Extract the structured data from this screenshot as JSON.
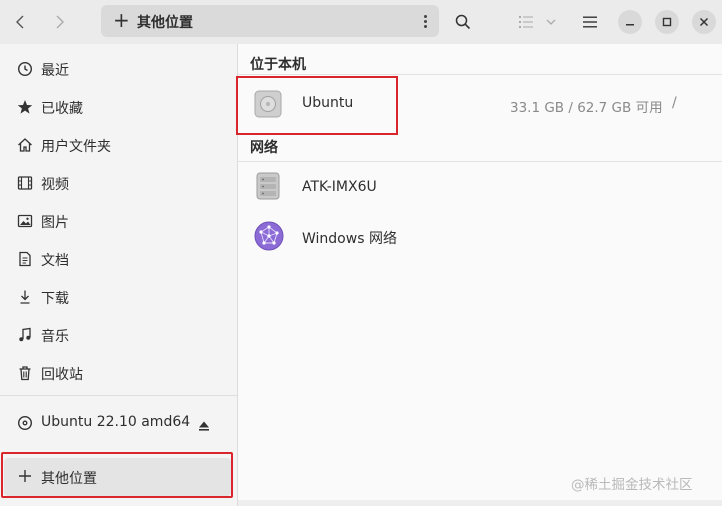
{
  "header": {
    "path_label": "其他位置"
  },
  "sidebar": {
    "items": [
      {
        "label": "最近",
        "icon": "clock-icon"
      },
      {
        "label": "已收藏",
        "icon": "star-icon"
      },
      {
        "label": "用户文件夹",
        "icon": "home-icon"
      },
      {
        "label": "视频",
        "icon": "film-icon"
      },
      {
        "label": "图片",
        "icon": "image-icon"
      },
      {
        "label": "文档",
        "icon": "document-icon"
      },
      {
        "label": "下载",
        "icon": "download-icon"
      },
      {
        "label": "音乐",
        "icon": "music-icon"
      },
      {
        "label": "回收站",
        "icon": "trash-icon"
      }
    ],
    "device": {
      "label": "Ubuntu 22.10 amd64",
      "icon": "disc-icon"
    },
    "other_locations": {
      "label": "其他位置",
      "icon": "plus-icon"
    }
  },
  "main": {
    "local_section": "位于本机",
    "local_items": [
      {
        "name": "Ubuntu",
        "info": "33.1 GB / 62.7 GB 可用",
        "mount": "/",
        "icon": "drive-icon"
      }
    ],
    "network_section": "网络",
    "network_items": [
      {
        "name": "ATK-IMX6U",
        "icon": "server-icon"
      },
      {
        "name": "Windows 网络",
        "icon": "network-globe-icon"
      }
    ]
  },
  "watermark": "@稀土掘金技术社区",
  "colors": {
    "highlight_border": "#d9262c",
    "network_icon": "#7f5ccf"
  }
}
